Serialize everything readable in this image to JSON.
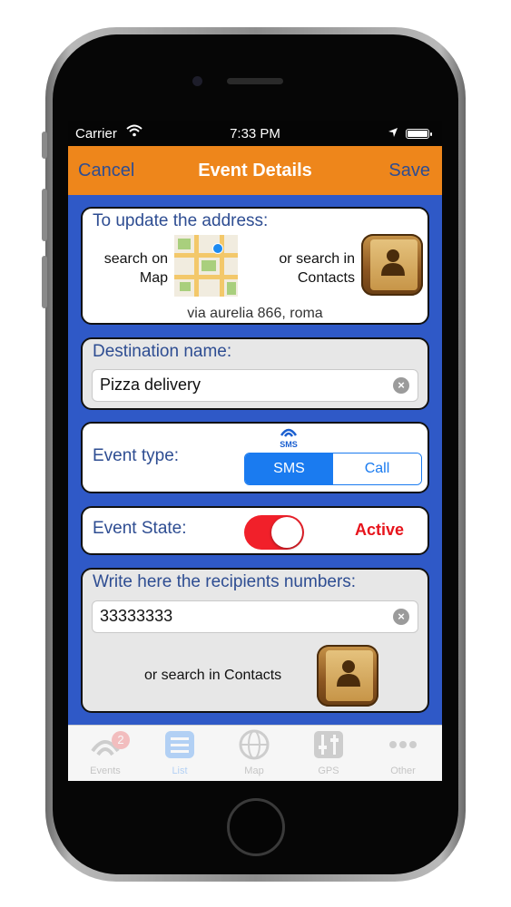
{
  "status_bar": {
    "carrier": "Carrier",
    "time": "7:33 PM"
  },
  "nav": {
    "cancel": "Cancel",
    "title": "Event Details",
    "save": "Save"
  },
  "address": {
    "heading": "To update the address:",
    "search_map": "search on\nMap",
    "search_contacts": "or search in\nContacts",
    "current": "via aurelia 866, roma"
  },
  "destination": {
    "label": "Destination name:",
    "value": "Pizza delivery"
  },
  "event_type": {
    "label": "Event type:",
    "icon_text": "SMS",
    "options": [
      "SMS",
      "Call"
    ],
    "selected": "SMS"
  },
  "event_state": {
    "label": "Event State:",
    "on": true,
    "status": "Active"
  },
  "recipients": {
    "label": "Write here the recipients numbers:",
    "value": "33333333",
    "search_contacts": "or search in Contacts"
  },
  "tabs": [
    {
      "label": "Events",
      "icon": "wifi-signal-icon",
      "badge": "2"
    },
    {
      "label": "List",
      "icon": "list-icon",
      "active": true
    },
    {
      "label": "Map",
      "icon": "globe-icon"
    },
    {
      "label": "GPS",
      "icon": "sliders-icon"
    },
    {
      "label": "Other",
      "icon": "more-icon"
    }
  ],
  "colors": {
    "nav": "#ee861b",
    "background": "#2f59c7",
    "accent": "#1a7bf0",
    "toggle": "#f1202a",
    "label": "#2e4d92"
  }
}
